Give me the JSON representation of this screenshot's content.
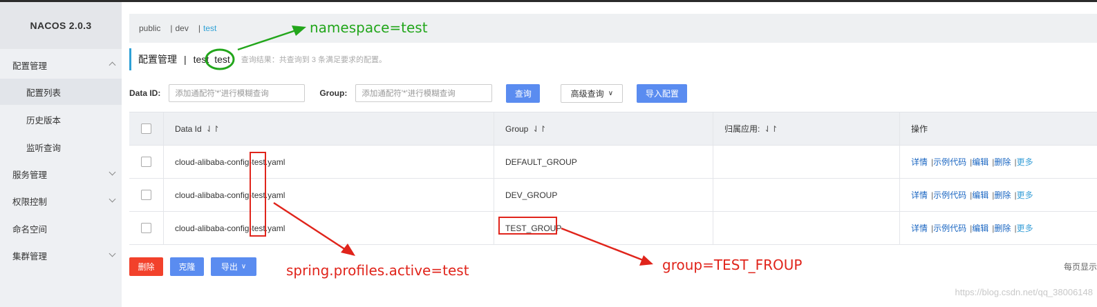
{
  "app": {
    "brand": "NACOS 2.0.3"
  },
  "sidebar": {
    "items": [
      {
        "label": "配置管理"
      },
      {
        "label": "配置列表"
      },
      {
        "label": "历史版本"
      },
      {
        "label": "监听查询"
      },
      {
        "label": "服务管理"
      },
      {
        "label": "权限控制"
      },
      {
        "label": "命名空间"
      },
      {
        "label": "集群管理"
      }
    ]
  },
  "namespaces": {
    "items": [
      "public",
      "dev",
      "test"
    ],
    "separator": "|",
    "active": "test"
  },
  "title": {
    "main": "配置管理",
    "separator": "|",
    "namespace_name": "test",
    "namespace_id": "test",
    "hint": "查询结果：共查询到 3 条满足要求的配置。"
  },
  "filters": {
    "data_id_label": "Data ID:",
    "data_id_placeholder": "添加通配符'*'进行模糊查询",
    "group_label": "Group:",
    "group_placeholder": "添加通配符'*'进行模糊查询",
    "query_button": "查询",
    "advanced_button": "高级查询",
    "import_button": "导入配置"
  },
  "table": {
    "columns": [
      "Data Id",
      "Group",
      "归属应用:",
      "操作"
    ],
    "sort_icon": "⇃↾",
    "rows": [
      {
        "data_id": "cloud-alibaba-config-test.yaml",
        "group": "DEFAULT_GROUP",
        "app": ""
      },
      {
        "data_id": "cloud-alibaba-config-test.yaml",
        "group": "DEV_GROUP",
        "app": ""
      },
      {
        "data_id": "cloud-alibaba-config-test.yaml",
        "group": "TEST_GROUP",
        "app": ""
      }
    ],
    "actions": [
      "详情",
      "示例代码",
      "编辑",
      "删除",
      "更多"
    ],
    "action_separator": "|"
  },
  "bottom": {
    "delete": "删除",
    "clone": "克隆",
    "export": "导出"
  },
  "footer": {
    "page_size_label": "每页显示",
    "watermark": "https://blog.csdn.net/qq_38006148"
  },
  "annotations": {
    "namespace": "namespace=test",
    "profile": "spring.profiles.active=test",
    "group": "group=TEST_FROUP"
  },
  "colors": {
    "accent": "#2fa1d6",
    "primary_button": "#5a8cf0",
    "danger_button": "#f2412b",
    "annotation_green": "#22a61b",
    "annotation_red": "#e0241b"
  }
}
